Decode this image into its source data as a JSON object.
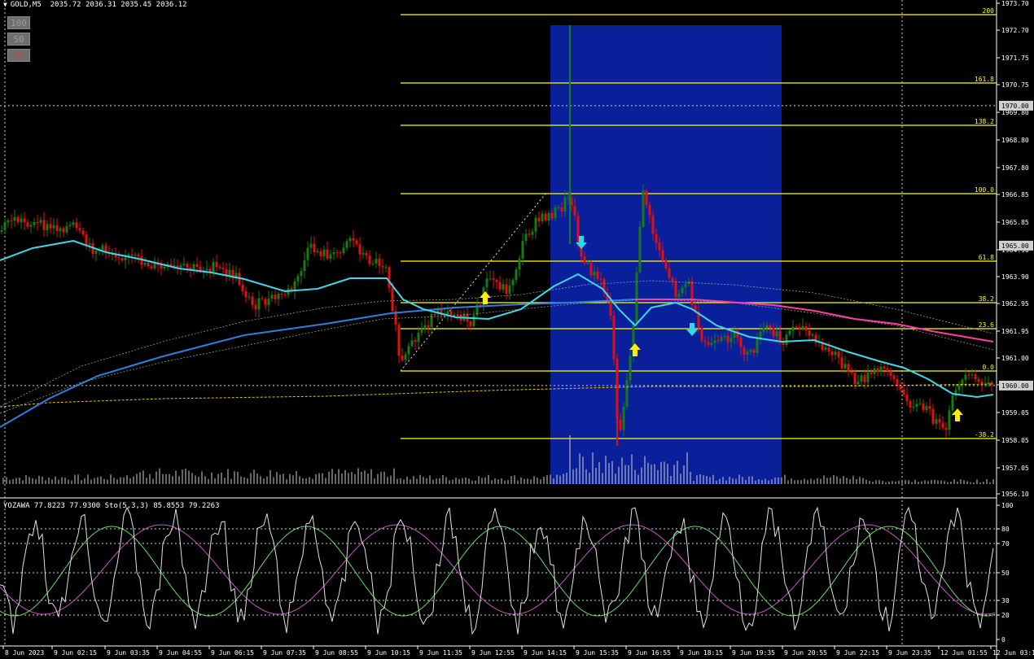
{
  "header": {
    "title": "GOLD,M5",
    "ohlc": "2035.72 2036.31 2035.45 2036.12"
  },
  "zoom_buttons": [
    "100",
    "50",
    "25"
  ],
  "indicator_header": "YOZAWA 77.8223 77.9300  Sto(5,3,3) 85.8553 79.2263",
  "price_axis": {
    "labels": [
      "1973.70",
      "1972.70",
      "1971.75",
      "1970.75",
      "1969.80",
      "1968.80",
      "1967.80",
      "1966.85",
      "1965.85",
      "1964.90",
      "1963.90",
      "1962.95",
      "1961.95",
      "1961.00",
      "1960.00",
      "1959.05",
      "1958.05",
      "1957.05",
      "1956.10"
    ],
    "marker_labels": [
      "1970.00",
      "1965.00",
      "1960.00"
    ]
  },
  "indicator_axis": {
    "labels": [
      "100",
      "80",
      "70",
      "50",
      "30",
      "20",
      "0"
    ]
  },
  "time_axis": {
    "labels": [
      "8 Jun 2023",
      "9 Jun 02:15",
      "9 Jun 03:35",
      "9 Jun 04:55",
      "9 Jun 06:15",
      "9 Jun 07:35",
      "9 Jun 08:55",
      "9 Jun 10:15",
      "9 Jun 11:35",
      "9 Jun 12:55",
      "9 Jun 14:15",
      "9 Jun 15:35",
      "9 Jun 16:55",
      "9 Jun 18:15",
      "9 Jun 19:35",
      "9 Jun 20:55",
      "9 Jun 22:15",
      "9 Jun 23:35",
      "12 Jun 01:55",
      "12 Jun 03:15"
    ]
  },
  "fibonacci": {
    "levels": [
      "200",
      "161.8",
      "138.2",
      "100.0",
      "61.8",
      "38.2",
      "23.6",
      "0.0",
      "-38.2"
    ],
    "color": "#ffff00"
  },
  "colors": {
    "bull": "#1a7a1a",
    "bear": "#e01010",
    "ma_fast": "#40d8e8",
    "ma_slow": "#2f7fe0",
    "ma_long": "#ff3fa0",
    "highlight": "#0a1f9a",
    "arrow_up": "#ffee00",
    "arrow_down": "#30d8e8"
  },
  "chart_data": {
    "type": "candlestick",
    "symbol": "GOLD",
    "timeframe": "M5",
    "y_range": [
      1956.1,
      1973.7
    ]
  }
}
